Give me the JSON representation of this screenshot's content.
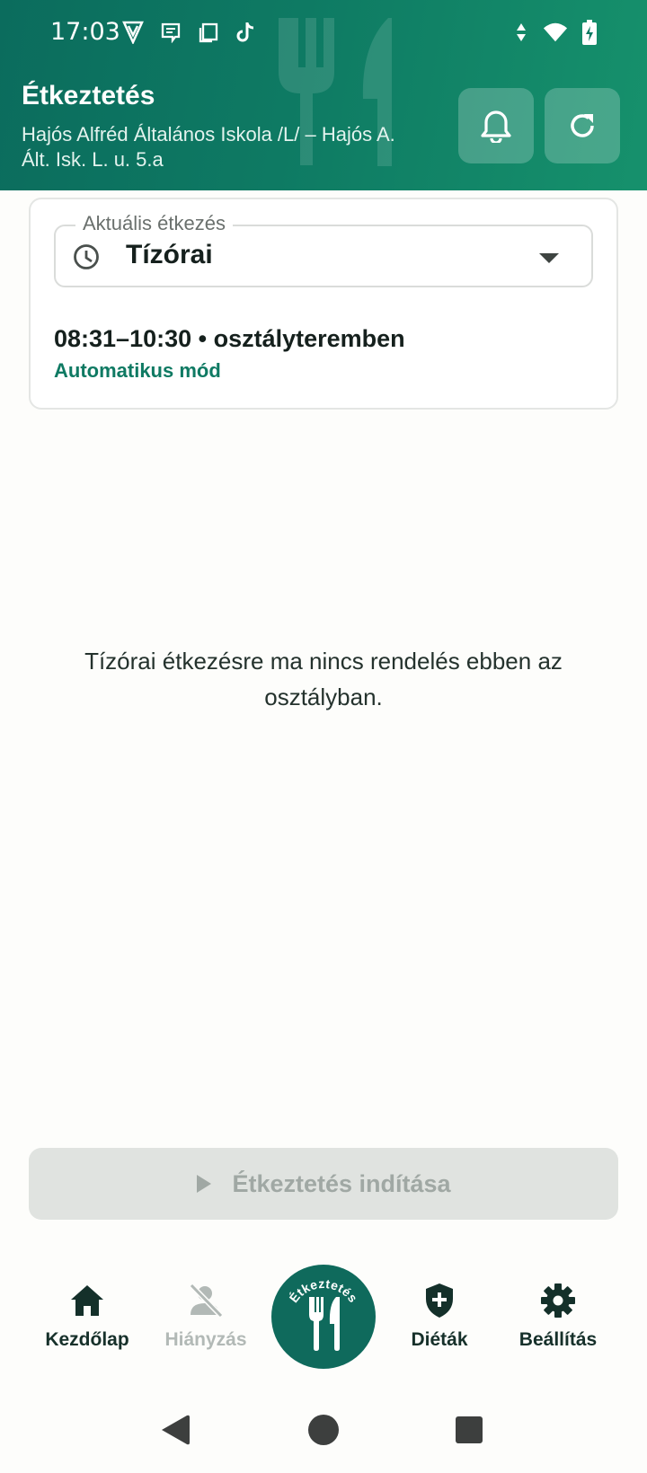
{
  "status_bar": {
    "time": "17:03"
  },
  "header": {
    "title": "Étkeztetés",
    "subtitle": "Hajós Alfréd Általános Iskola /L/ – Hajós A. Ált. Isk.  L. u. 5.a"
  },
  "meal_card": {
    "legend": "Aktuális étkezés",
    "selected_meal": "Tízórai",
    "time_location": "08:31–10:30 • osztályteremben",
    "mode": "Automatikus mód"
  },
  "empty_message": "Tízórai étkezésre ma nincs rendelés ebben az osztályban.",
  "start_button": {
    "label": "Étkeztetés indítása"
  },
  "bottom_nav": {
    "items": [
      {
        "label": "Kezdőlap",
        "icon": "home-icon"
      },
      {
        "label": "Hiányzás",
        "icon": "person-off-icon"
      },
      {
        "label": "Étkeztetés",
        "icon": "fork-knife-icon"
      },
      {
        "label": "Diéták",
        "icon": "shield-plus-icon"
      },
      {
        "label": "Beállítás",
        "icon": "gear-icon"
      }
    ]
  },
  "colors": {
    "primary": "#0f6a5c",
    "accent": "#0f7a63",
    "background": "#fdfdfb"
  }
}
